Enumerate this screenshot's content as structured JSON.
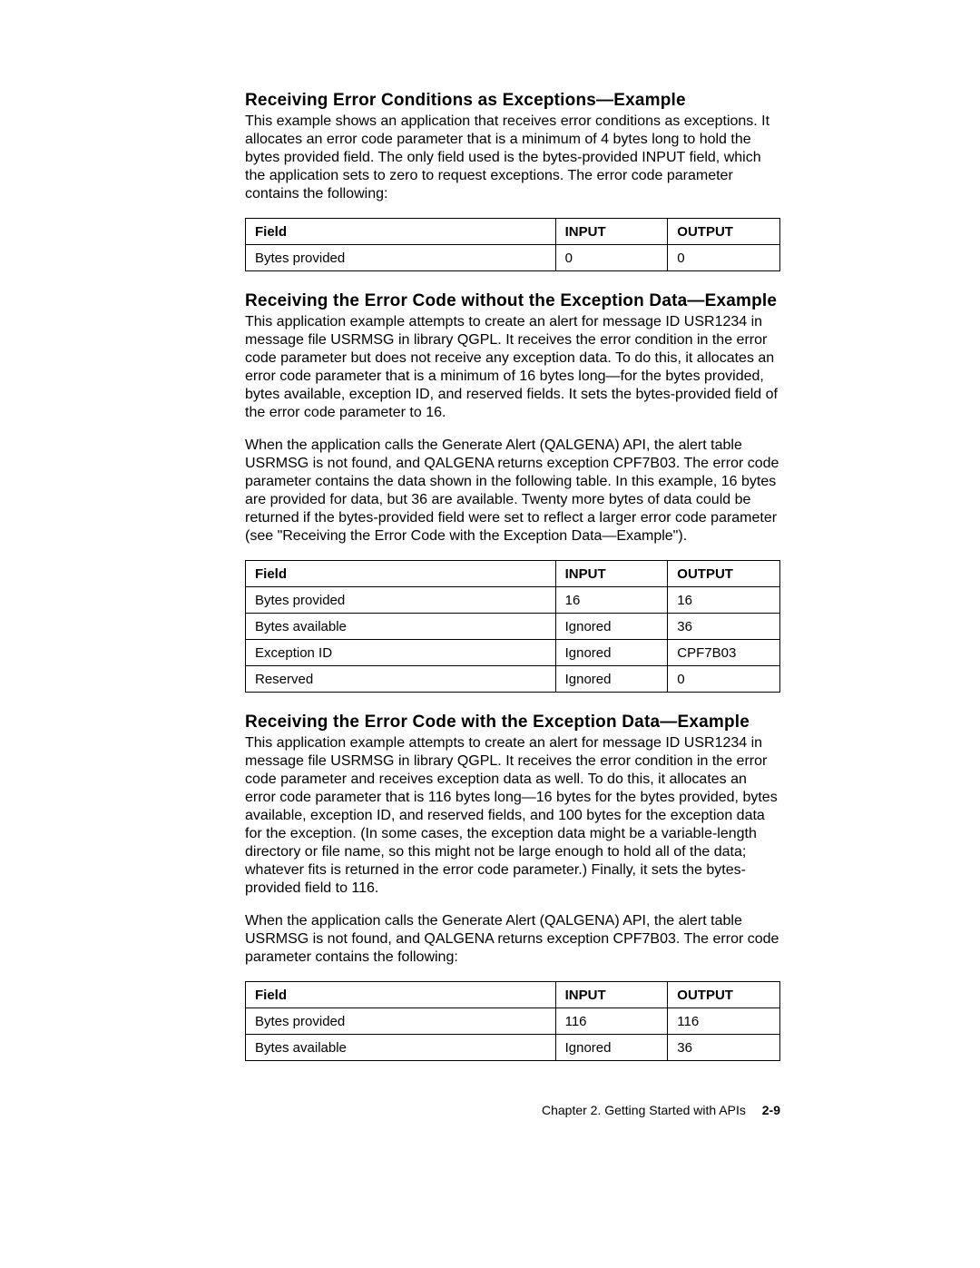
{
  "section1": {
    "heading": "Receiving Error Conditions as Exceptions—Example",
    "para1": "This example shows an application that receives error conditions as exceptions. It allocates an error code parameter that is a minimum of 4 bytes long to hold the bytes provided field. The only field used is the bytes-provided INPUT field, which the application sets to zero to request exceptions. The error code parameter contains the following:",
    "table": {
      "head": {
        "c1": "Field",
        "c2": "INPUT",
        "c3": "OUTPUT"
      },
      "rows": [
        {
          "c1": "Bytes provided",
          "c2": "0",
          "c3": "0"
        }
      ]
    }
  },
  "section2": {
    "heading": "Receiving the Error Code without the Exception Data—Example",
    "para1": "This application example attempts to create an alert for message ID USR1234 in message file USRMSG in library QGPL. It receives the error condition in the error code parameter but does not receive any exception data. To do this, it allocates an error code parameter that is a minimum of 16 bytes long—for the bytes provided, bytes available, exception ID, and reserved fields. It sets the bytes-provided field of the error code parameter to 16.",
    "para2": "When the application calls the Generate Alert (QALGENA) API, the alert table USRMSG is not found, and QALGENA returns exception CPF7B03. The error code parameter contains the data shown in the following table. In this example, 16 bytes are provided for data, but 36 are available. Twenty more bytes of data could be returned if the bytes-provided field were set to reflect a larger error code parameter (see \"Receiving the Error Code with the Exception Data—Example\").",
    "table": {
      "head": {
        "c1": "Field",
        "c2": "INPUT",
        "c3": "OUTPUT"
      },
      "rows": [
        {
          "c1": "Bytes provided",
          "c2": "16",
          "c3": "16"
        },
        {
          "c1": "Bytes available",
          "c2": "Ignored",
          "c3": "36"
        },
        {
          "c1": "Exception ID",
          "c2": "Ignored",
          "c3": "CPF7B03"
        },
        {
          "c1": "Reserved",
          "c2": "Ignored",
          "c3": "0"
        }
      ]
    }
  },
  "section3": {
    "heading": "Receiving the Error Code with the Exception Data—Example",
    "para1": "This application example attempts to create an alert for message ID USR1234 in message file USRMSG in library QGPL. It receives the error condition in the error code parameter and receives exception data as well. To do this, it allocates an error code parameter that is 116 bytes long—16 bytes for the bytes provided, bytes available, exception ID, and reserved fields, and 100 bytes for the exception data for the exception. (In some cases, the exception data might be a variable-length directory or file name, so this might not be large enough to hold all of the data; whatever fits is returned in the error code parameter.) Finally, it sets the bytes-provided field to 116.",
    "para2": "When the application calls the Generate Alert (QALGENA) API, the alert table USRMSG is not found, and QALGENA returns exception CPF7B03. The error code parameter contains the following:",
    "table": {
      "head": {
        "c1": "Field",
        "c2": "INPUT",
        "c3": "OUTPUT"
      },
      "rows": [
        {
          "c1": "Bytes provided",
          "c2": "116",
          "c3": "116"
        },
        {
          "c1": "Bytes available",
          "c2": "Ignored",
          "c3": "36"
        }
      ]
    }
  },
  "footer": {
    "chapter": "Chapter 2.  Getting Started with APIs",
    "page": "2-9"
  }
}
